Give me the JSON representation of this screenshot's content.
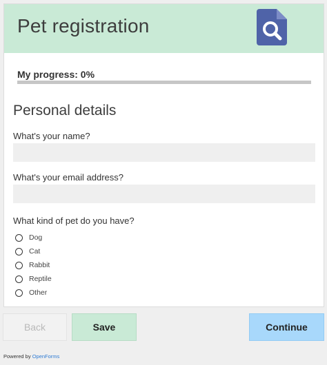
{
  "header": {
    "title": "Pet registration",
    "logo_icon": "search-document-icon",
    "background": "#c9ead6",
    "logo_color": "#4f63a8"
  },
  "progress": {
    "label": "My progress: 0%",
    "fraction": 0
  },
  "section": {
    "title": "Personal details"
  },
  "fields": {
    "name": {
      "label": "What's your name?",
      "value": "",
      "placeholder": ""
    },
    "email": {
      "label": "What's your email address?",
      "value": "",
      "placeholder": ""
    },
    "pet": {
      "label": "What kind of pet do you have?",
      "options": [
        "Dog",
        "Cat",
        "Rabbit",
        "Reptile",
        "Other"
      ],
      "selected": null
    }
  },
  "buttons": {
    "back": "Back",
    "save": "Save",
    "continue": "Continue"
  },
  "footer": {
    "prefix": "Powered by",
    "brand": "OpenForms"
  },
  "colors": {
    "accent": "#c9ead6",
    "continue": "#a8d8fb",
    "link": "#2f7bd3"
  }
}
